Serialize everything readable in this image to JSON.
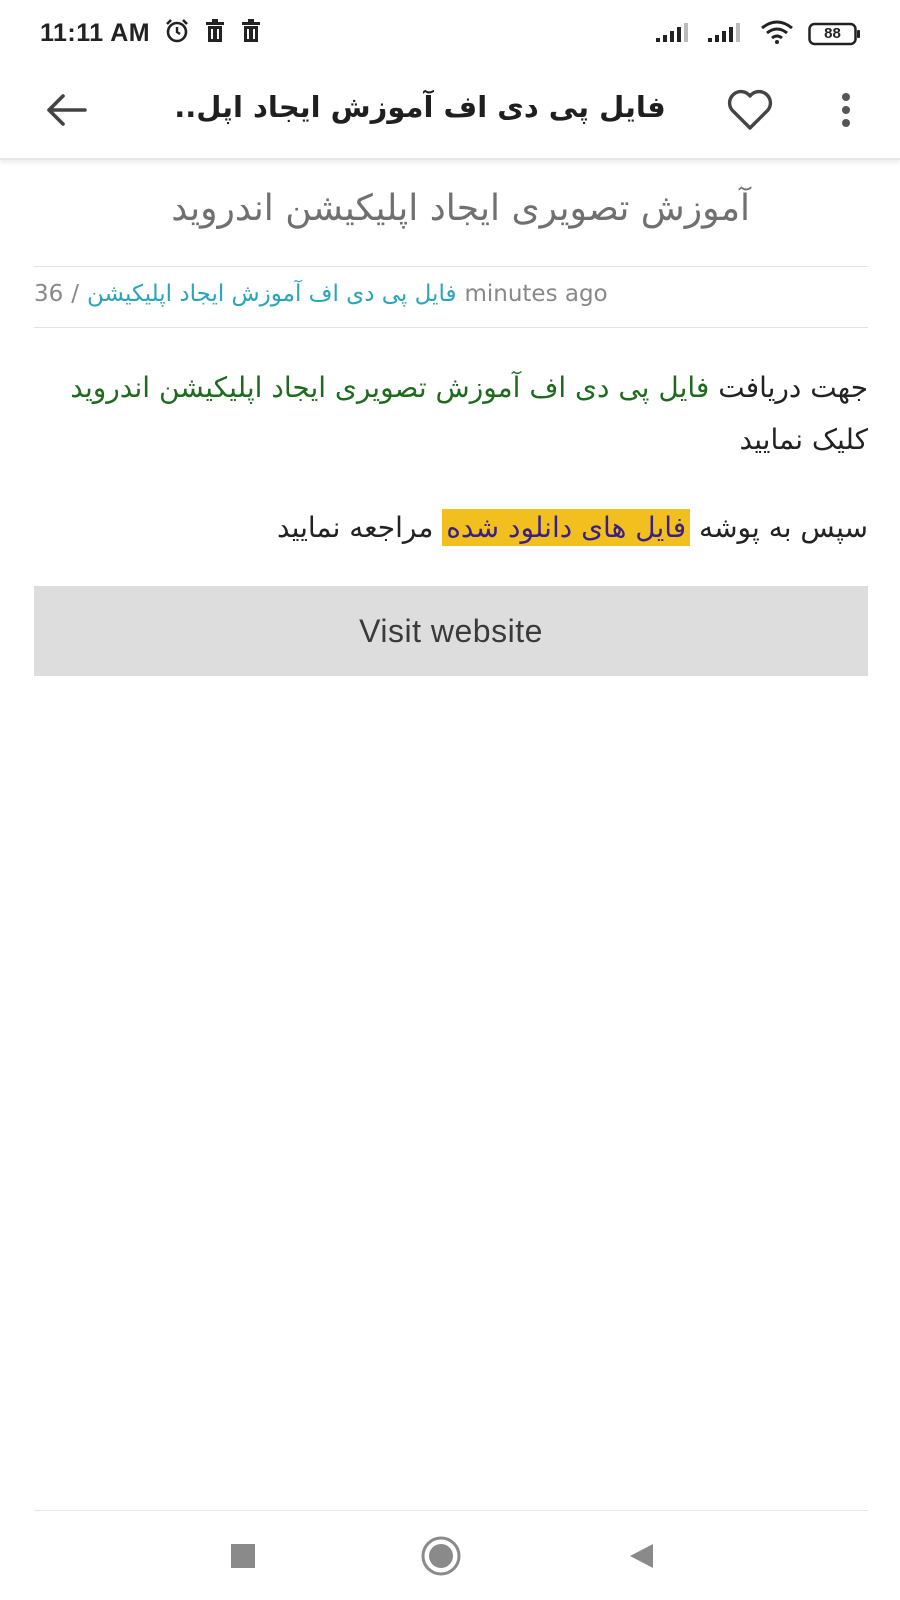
{
  "status_bar": {
    "time": "11:11 AM",
    "battery": "88",
    "icons": [
      "alarm-icon",
      "trash-icon",
      "trash-icon",
      "signal-icon",
      "signal-icon",
      "wifi-icon",
      "battery-icon"
    ]
  },
  "app_bar": {
    "title": "فایل پی دی اف آموزش ایجاد اپل..",
    "back_icon": "arrow-left-icon",
    "favorite_icon": "heart-outline-icon",
    "menu_icon": "more-vertical-icon"
  },
  "article": {
    "title": "آموزش تصویری ایجاد اپلیکیشن اندروید",
    "meta": {
      "time_ago": "minutes ago",
      "category_link": "فایل پی دی اف آموزش ایجاد اپلیکیشن",
      "separator": "/",
      "count": "36"
    },
    "paragraph1": {
      "prefix": "جهت دریافت ",
      "highlighted_link": "فایل پی دی اف آموزش تصویری ایجاد اپلیکیشن اندروید",
      "suffix": " کلیک نمایید"
    },
    "paragraph2": {
      "prefix": "سپس به پوشه ",
      "highlight": "فایل های دانلود شده",
      "suffix": " مراجعه نمایید"
    },
    "visit_button": "Visit website"
  },
  "nav_bar": {
    "recent_icon": "square-icon",
    "home_icon": "circle-icon",
    "back_icon": "triangle-back-icon"
  },
  "colors": {
    "link_teal": "#2aa5b9",
    "link_green": "#1e6b1e",
    "highlight_yellow": "#f2c01e",
    "button_gray": "#dddddd"
  }
}
